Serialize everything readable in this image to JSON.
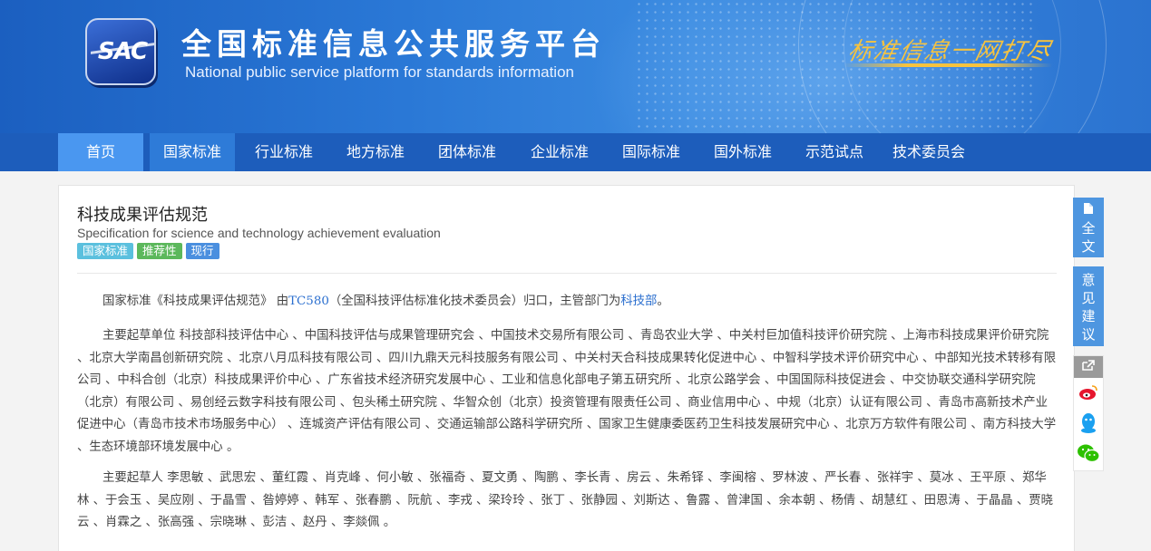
{
  "header": {
    "logo_text": "SAC",
    "title_cn": "全国标准信息公共服务平台",
    "title_en": "National public service platform  for standards information",
    "slogan": "标准信息一网打尽"
  },
  "nav": {
    "items": [
      "首页",
      "国家标准",
      "行业标准",
      "地方标准",
      "团体标准",
      "企业标准",
      "国际标准",
      "国外标准",
      "示范试点",
      "技术委员会"
    ]
  },
  "standard": {
    "title": "科技成果评估规范",
    "title_en": "Specification for science and technology achievement evaluation",
    "badges": [
      {
        "label": "国家标准",
        "color": "#5bc0de"
      },
      {
        "label": "推荐性",
        "color": "#5cb85c"
      },
      {
        "label": "现行",
        "color": "#4a8fdf"
      }
    ],
    "intro": {
      "prefix": "国家标准《科技成果评估规范》 由",
      "committee_link": "TC580",
      "middle": "（全国科技评估标准化技术委员会）归口，主管部门为",
      "dept_link": "科技部",
      "suffix": "。"
    },
    "drafting_units": "主要起草单位 科技部科技评估中心 、中国科技评估与成果管理研究会 、中国技术交易所有限公司 、青岛农业大学 、中关村巨加值科技评价研究院 、上海市科技成果评价研究院 、北京大学南昌创新研究院 、北京八月瓜科技有限公司 、四川九鼎天元科技服务有限公司 、中关村天合科技成果转化促进中心 、中智科学技术评价研究中心 、中部知光技术转移有限公司 、中科合创（北京）科技成果评价中心 、广东省技术经济研究发展中心 、工业和信息化部电子第五研究所 、北京公路学会 、中国国际科技促进会 、中交协联交通科学研究院（北京）有限公司 、易创经云数字科技有限公司 、包头稀土研究院 、华智众创（北京）投资管理有限责任公司 、商业信用中心 、中规（北京）认证有限公司 、青岛市高新技术产业促进中心（青岛市技术市场服务中心） 、连城资产评估有限公司 、交通运输部公路科学研究所 、国家卫生健康委医药卫生科技发展研究中心 、北京万方软件有限公司 、南方科技大学 、生态环境部环境发展中心 。",
    "drafters": "主要起草人 李思敏 、武思宏 、董红霞 、肖克峰 、何小敏 、张福奇 、夏文勇 、陶鹏 、李长青 、房云 、朱希铎 、李闽榕 、罗林波 、严长春 、张祥宇 、莫冰 、王平原 、郑华林 、于会玉 、吴应刚 、于晶雪 、昝婷婷 、韩军 、张春鹏 、阮航 、李戎 、梁玲玲 、张丁 、张静园 、刘斯达 、鲁露 、曾津国 、余本朝 、杨倩 、胡慧红 、田恩涛 、于晶晶 、贾晓云 、肖霖之 、张高强 、宗晓琳 、彭洁 、赵丹 、李燚佩 。"
  },
  "sidebar": {
    "fulltext_label": "全文",
    "feedback_label": "意见建议"
  }
}
